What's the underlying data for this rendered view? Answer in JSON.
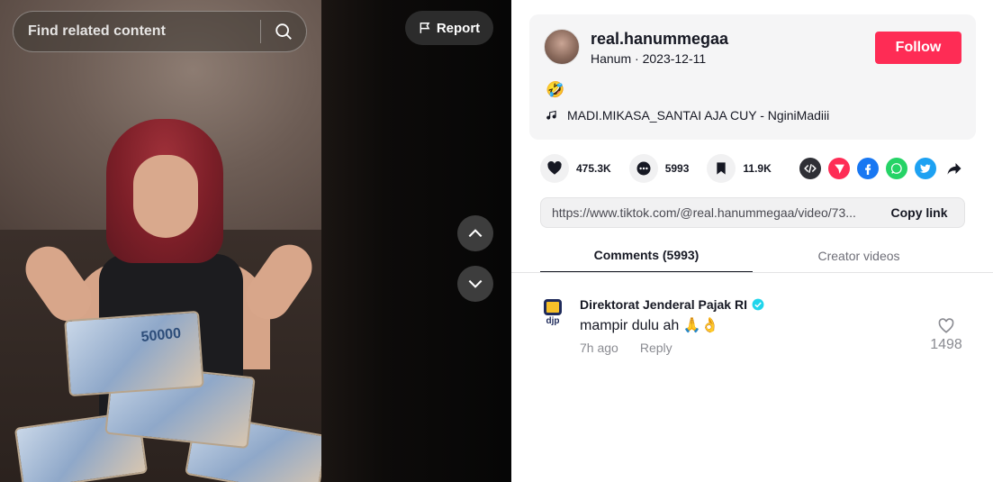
{
  "video": {
    "search_placeholder": "Find related content",
    "report_label": "Report",
    "banknote_label": "50000"
  },
  "author": {
    "username": "real.hanummegaa",
    "nickname": "Hanum",
    "date": "2023-12-11",
    "nick_separator": " · ",
    "follow_label": "Follow",
    "description_emoji": "🤣",
    "music": "MADI.MIKASA_SANTAI AJA CUY - NginiMadiii"
  },
  "actions": {
    "likes": "475.3K",
    "comments": "5993",
    "saves": "11.9K"
  },
  "share_icons": [
    "embed-icon",
    "send-icon",
    "facebook-icon",
    "whatsapp-icon",
    "twitter-icon",
    "share-arrow-icon"
  ],
  "link": {
    "url": "https://www.tiktok.com/@real.hanummegaa/video/73...",
    "copy_label": "Copy link"
  },
  "tabs": {
    "comments_label": "Comments (5993)",
    "creator_videos_label": "Creator videos"
  },
  "comment": {
    "avatar_text": "djp",
    "author": "Direktorat Jenderal Pajak RI",
    "text": "mampir dulu ah 🙏👌",
    "time": "7h ago",
    "reply_label": "Reply",
    "likes": "1498"
  },
  "colors": {
    "follow": "#fe2c55",
    "verified": "#20d5ec",
    "facebook": "#1877f2",
    "whatsapp": "#25d366",
    "twitter": "#1da1f2",
    "send": "#fe2c55"
  }
}
